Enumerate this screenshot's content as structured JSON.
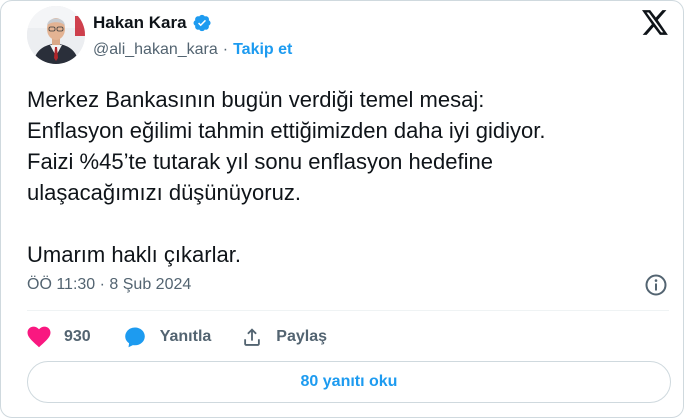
{
  "author": {
    "display_name": "Hakan Kara",
    "handle": "@ali_hakan_kara",
    "separator": "·",
    "follow_label": "Takip et",
    "verified": true,
    "verified_color": "#1d9bf0"
  },
  "tweet": {
    "lines": [
      "Merkez Bankasının bugün verdiği temel mesaj:",
      "Enflasyon eğilimi tahmin ettiğimizden daha iyi gidiyor.",
      "Faizi %45’te tutarak yıl sonu enflasyon hedefine",
      "ulaşacağımızı düşünüyoruz."
    ],
    "closing": "Umarım haklı çıkarlar.",
    "timestamp": "ÖÖ 11:30 · 8 Şub 2024"
  },
  "actions": {
    "like_count": "930",
    "like_color": "#f91880",
    "reply_label": "Yanıtla",
    "reply_color": "#1d9bf0",
    "share_label": "Paylaş"
  },
  "read_replies_label": "80 yanıtı oku",
  "icons": {
    "brand": "x-logo-icon",
    "info": "info-icon",
    "like": "heart-icon",
    "reply": "reply-bubble-icon",
    "share": "share-icon",
    "verified": "verified-badge-icon"
  },
  "colors": {
    "text": "#0f1419",
    "secondary": "#536471",
    "accent": "#1d9bf0",
    "border": "#cfd9de"
  }
}
